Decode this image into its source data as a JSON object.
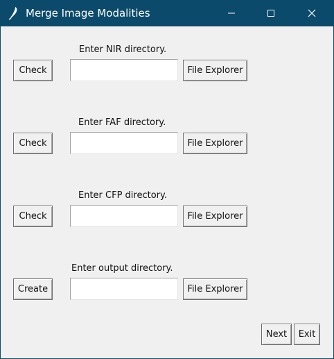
{
  "window": {
    "title": "Merge Image Modalities"
  },
  "sections": [
    {
      "label": "Enter NIR directory.",
      "action_label": "Check",
      "input_value": "",
      "browse_label": "File Explorer"
    },
    {
      "label": "Enter FAF directory.",
      "action_label": "Check",
      "input_value": "",
      "browse_label": "File Explorer"
    },
    {
      "label": "Enter CFP directory.",
      "action_label": "Check",
      "input_value": "",
      "browse_label": "File Explorer"
    },
    {
      "label": "Enter output directory.",
      "action_label": "Create",
      "input_value": "",
      "browse_label": "File Explorer"
    }
  ],
  "footer": {
    "next_label": "Next",
    "exit_label": "Exit"
  },
  "icons": {
    "app": "feather-icon",
    "minimize": "minimize-icon",
    "maximize": "maximize-icon",
    "close": "close-icon"
  },
  "colors": {
    "titlebar": "#0b4a6b",
    "background": "#f0f0f0"
  }
}
